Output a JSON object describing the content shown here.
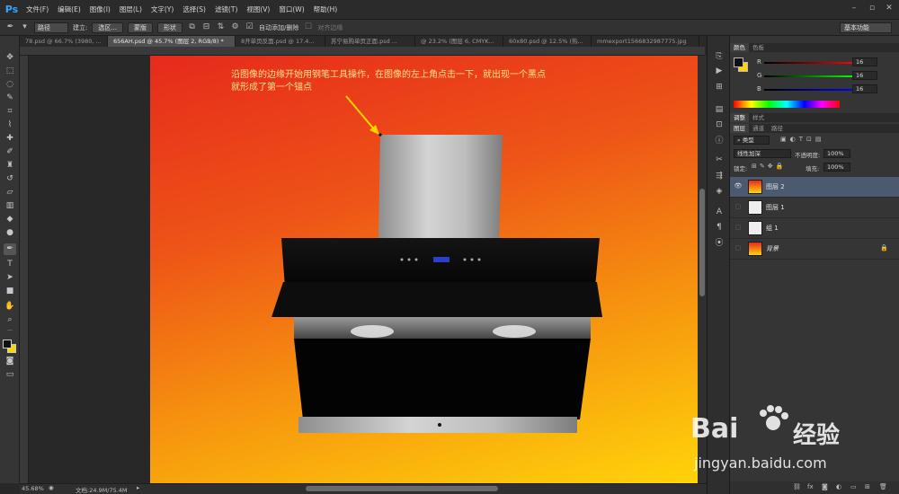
{
  "app": {
    "logo": "Ps"
  },
  "menu": [
    "文件(F)",
    "编辑(E)",
    "图像(I)",
    "图层(L)",
    "文字(Y)",
    "选择(S)",
    "滤镜(T)",
    "视图(V)",
    "窗口(W)",
    "帮助(H)"
  ],
  "options": {
    "mode": "路径",
    "build_label": "建立:",
    "selection_btn": "选区...",
    "mask_btn": "蒙版",
    "shape_btn": "形状",
    "auto_add_delete": "自动添加/删除",
    "align_edges": "对齐边缘",
    "workspace": "基本功能"
  },
  "tabs": [
    {
      "label": "78.psd @ 66.7% (3980, ...",
      "active": false
    },
    {
      "label": "656AH.psd @ 45.7% (图层 2, RGB/8) *",
      "active": true
    },
    {
      "label": "8开单页反面.psd @ 17.4...",
      "active": false
    },
    {
      "label": "苏宁易购单页正面.psd ...",
      "active": false
    },
    {
      "label": "@ 23.2% (图层 6, CMYK...",
      "active": false
    },
    {
      "label": "60x80.psd @ 12.5% (热...",
      "active": false
    },
    {
      "label": "mmexport1566832987775.jpg",
      "active": false
    }
  ],
  "annotation": {
    "line1": "沿图像的边缘开始用钢笔工具操作，在图像的左上角点击一下，就出现一个黑点",
    "line2": "就形成了第一个锚点"
  },
  "status": {
    "zoom": "45.68%",
    "doc_info": "文档:24.9M/75.4M"
  },
  "color_panel": {
    "tabs": [
      "颜色",
      "色板"
    ],
    "r_label": "R",
    "g_label": "G",
    "b_label": "B",
    "r": "16",
    "g": "16",
    "b": "16",
    "fg_color": "#101010",
    "bg_color": "#ffd400"
  },
  "adjust_tabs": [
    "调整",
    "样式"
  ],
  "layers_panel": {
    "tabs": [
      "图层",
      "通道",
      "路径"
    ],
    "filter": "类型",
    "blend_mode": "线性加深",
    "opacity_label": "不透明度:",
    "opacity": "100%",
    "lock_label": "锁定:",
    "fill_label": "填充:",
    "fill": "100%",
    "layers": [
      {
        "name": "图层 2",
        "selected": true,
        "visible": true,
        "italic": false
      },
      {
        "name": "图层 1",
        "selected": false,
        "visible": false,
        "italic": false
      },
      {
        "name": "组 1",
        "selected": false,
        "visible": false,
        "italic": false
      },
      {
        "name": "背景",
        "selected": false,
        "visible": false,
        "italic": true
      }
    ]
  },
  "watermark": {
    "brand_a": "Bai",
    "brand_b": "经验",
    "url": "jingyan.baidu.com"
  }
}
